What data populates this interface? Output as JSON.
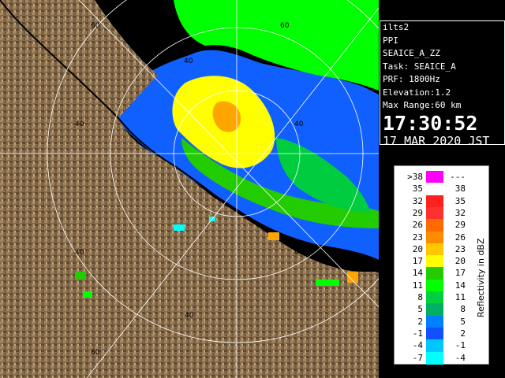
{
  "info": {
    "lines": [
      "ilts2",
      "PPI",
      "SEAICE_A_ZZ",
      "Task: SEAICE_A",
      "PRF: 1800Hz",
      "Elevation:1.2",
      "Max Range:60 km"
    ],
    "time": "17:30:52",
    "date": "17 MAR 2020 JST"
  },
  "legend": {
    "title": "Reflectivity in dBZ",
    "rows": [
      {
        "low": ">38",
        "high": "---",
        "color": "#ff00ff"
      },
      {
        "low": "35",
        "high": "38",
        "color": "#ffffff"
      },
      {
        "low": "32",
        "high": "35",
        "color": "#ff2020"
      },
      {
        "low": "29",
        "high": "32",
        "color": "#ff3030"
      },
      {
        "low": "26",
        "high": "29",
        "color": "#ff6a00"
      },
      {
        "low": "23",
        "high": "26",
        "color": "#ff8c00"
      },
      {
        "low": "20",
        "high": "23",
        "color": "#ffc800"
      },
      {
        "low": "17",
        "high": "20",
        "color": "#ffff00"
      },
      {
        "low": "14",
        "high": "17",
        "color": "#22cc00"
      },
      {
        "low": "11",
        "high": "14",
        "color": "#00ff00"
      },
      {
        "low": "8",
        "high": "11",
        "color": "#00d040"
      },
      {
        "low": "5",
        "high": "8",
        "color": "#00b060"
      },
      {
        "low": "2",
        "high": "5",
        "color": "#0080ff"
      },
      {
        "low": "-1",
        "high": "2",
        "color": "#1050ff"
      },
      {
        "low": "-4",
        "high": "-1",
        "color": "#00c8ff"
      },
      {
        "low": "-7",
        "high": "-4",
        "color": "#00ffff"
      }
    ]
  },
  "range_labels": [
    "60",
    "60",
    "40",
    "40",
    "40",
    "40",
    "40",
    "40",
    "60"
  ],
  "colors": {
    "land": "#8a7050",
    "sea": "#000000",
    "rings": "#ffffff",
    "coastline": "#000000"
  }
}
